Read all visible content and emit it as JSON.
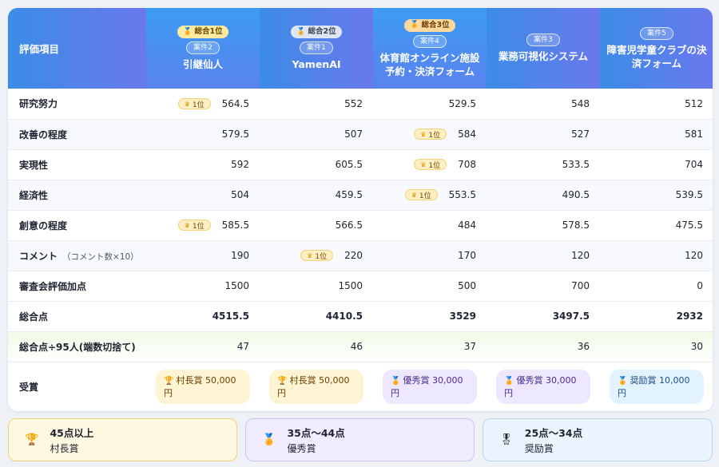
{
  "table": {
    "header_label": "評価項目",
    "columns": [
      {
        "overall_rank": "総合1位",
        "case": "案件2",
        "name": "引継仙人",
        "highlight": true
      },
      {
        "overall_rank": "総合2位",
        "case": "案件1",
        "name": "YamenAI",
        "highlight": false
      },
      {
        "overall_rank": "総合3位",
        "case": "案件4",
        "name": "体育館オンライン施設予約・決済フォーム",
        "highlight": true
      },
      {
        "overall_rank": "",
        "case": "案件3",
        "name": "業務可視化システム",
        "highlight": false
      },
      {
        "overall_rank": "",
        "case": "案件5",
        "name": "障害児学童クラブの決済フォーム",
        "highlight": false
      }
    ],
    "first_tag": "1位",
    "rows": [
      {
        "label": "研究努力",
        "sub": "",
        "values": [
          "564.5",
          "552",
          "529.5",
          "548",
          "512"
        ],
        "first_index": 0
      },
      {
        "label": "改善の程度",
        "sub": "",
        "values": [
          "579.5",
          "507",
          "584",
          "527",
          "581"
        ],
        "first_index": 2
      },
      {
        "label": "実現性",
        "sub": "",
        "values": [
          "592",
          "605.5",
          "708",
          "533.5",
          "704"
        ],
        "first_index": 2
      },
      {
        "label": "経済性",
        "sub": "",
        "values": [
          "504",
          "459.5",
          "553.5",
          "490.5",
          "539.5"
        ],
        "first_index": 2
      },
      {
        "label": "創意の程度",
        "sub": "",
        "values": [
          "585.5",
          "566.5",
          "484",
          "578.5",
          "475.5"
        ],
        "first_index": 0
      },
      {
        "label": "コメント",
        "sub": "（コメント数×10）",
        "values": [
          "190",
          "220",
          "170",
          "120",
          "120"
        ],
        "first_index": 1
      },
      {
        "label": "審査会評価加点",
        "sub": "",
        "values": [
          "1500",
          "1500",
          "500",
          "700",
          "0"
        ],
        "first_index": -1
      }
    ],
    "total": {
      "label": "総合点",
      "values": [
        "4515.5",
        "4410.5",
        "3529",
        "3497.5",
        "2932"
      ]
    },
    "average": {
      "label": "総合点÷95人(端数切捨て)",
      "values": [
        "47",
        "46",
        "37",
        "36",
        "30"
      ]
    },
    "award": {
      "label": "受賞",
      "values": [
        {
          "text": "村長賞 50,000円",
          "tier": "gold",
          "icon": "trophy-icon"
        },
        {
          "text": "村長賞 50,000円",
          "tier": "gold",
          "icon": "trophy-icon"
        },
        {
          "text": "優秀賞 30,000円",
          "tier": "purple",
          "icon": "medal-icon"
        },
        {
          "text": "優秀賞 30,000円",
          "tier": "purple",
          "icon": "medal-icon"
        },
        {
          "text": "奨励賞 10,000円",
          "tier": "blue",
          "icon": "medal-icon"
        }
      ]
    }
  },
  "legend": [
    {
      "range": "45点以上",
      "name": "村長賞",
      "tier": "gold",
      "icon": "trophy-icon"
    },
    {
      "range": "35点〜44点",
      "name": "優秀賞",
      "tier": "purple",
      "icon": "medal-icon"
    },
    {
      "range": "25点〜34点",
      "name": "奨励賞",
      "tier": "blue",
      "icon": "medal-icon"
    }
  ],
  "colors": {
    "header_start": "#3c8ce6",
    "header_end": "#6a78ee",
    "gold_bg": "#fff4d3",
    "purple_bg": "#ede8ff",
    "blue_bg": "#e3f2ff"
  }
}
